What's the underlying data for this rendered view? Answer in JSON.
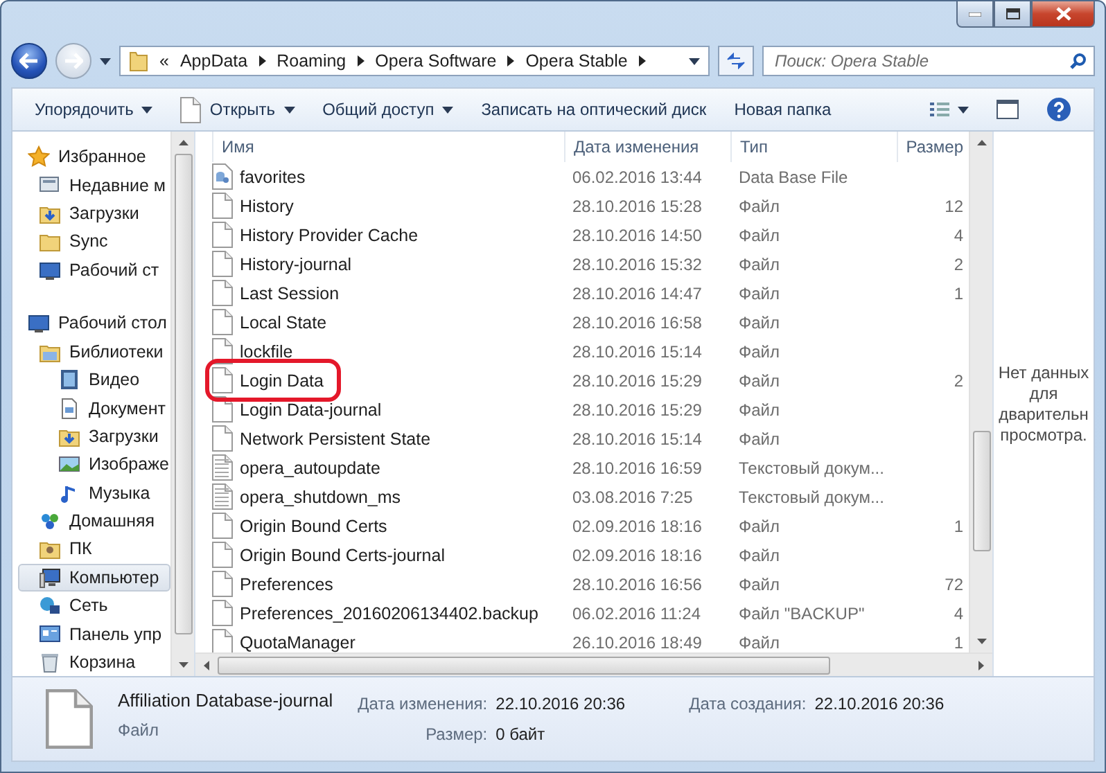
{
  "address_bar": {
    "overflow": "«",
    "segments": [
      "AppData",
      "Roaming",
      "Opera Software",
      "Opera Stable"
    ]
  },
  "search": {
    "placeholder": "Поиск: Opera Stable"
  },
  "toolbar": {
    "buttons": [
      {
        "label": "Упорядочить",
        "kind": "menu"
      },
      {
        "label": "Открыть",
        "kind": "open"
      },
      {
        "label": "Общий доступ",
        "kind": "menu"
      },
      {
        "label": "Записать на оптический диск",
        "kind": "plain"
      },
      {
        "label": "Новая папка",
        "kind": "plain"
      }
    ]
  },
  "navigation": [
    {
      "label": "Избранное",
      "kind": "star",
      "selected": false,
      "children": [
        {
          "label": "Недавние м",
          "kind": "recent",
          "selected": false
        },
        {
          "label": "Загрузки",
          "kind": "downloads",
          "selected": false
        },
        {
          "label": "Sync",
          "kind": "folder",
          "selected": false
        },
        {
          "label": "Рабочий ст",
          "kind": "desktop",
          "selected": false
        }
      ]
    },
    {
      "label": "Рабочий стол",
      "kind": "desktop",
      "selected": false,
      "children": [
        {
          "label": "Библиотеки",
          "kind": "library",
          "selected": false,
          "children": [
            {
              "label": "Видео",
              "kind": "video",
              "selected": false
            },
            {
              "label": "Документ",
              "kind": "document",
              "selected": false
            },
            {
              "label": "Загрузки",
              "kind": "downloads",
              "selected": false
            },
            {
              "label": "Изображе",
              "kind": "image",
              "selected": false
            },
            {
              "label": "Музыка",
              "kind": "music",
              "selected": false
            }
          ]
        },
        {
          "label": "Домашняя",
          "kind": "homegroup",
          "selected": false
        },
        {
          "label": "ПК",
          "kind": "user",
          "selected": false
        },
        {
          "label": "Компьютер",
          "kind": "computer",
          "selected": true
        },
        {
          "label": "Сеть",
          "kind": "network",
          "selected": false
        },
        {
          "label": "Панель упр",
          "kind": "control",
          "selected": false
        },
        {
          "label": "Корзина",
          "kind": "trash",
          "selected": false
        }
      ]
    }
  ],
  "table": {
    "columns": [
      "Имя",
      "Дата изменения",
      "Тип",
      "Размер"
    ],
    "rows": [
      {
        "name": "favorites",
        "kind": "database",
        "date": "06.02.2016 13:44",
        "type": "Data Base File",
        "size": ""
      },
      {
        "name": "History",
        "kind": "file",
        "date": "28.10.2016 15:28",
        "type": "Файл",
        "size": "12"
      },
      {
        "name": "History Provider Cache",
        "kind": "file",
        "date": "28.10.2016 14:50",
        "type": "Файл",
        "size": "4"
      },
      {
        "name": "History-journal",
        "kind": "file",
        "date": "28.10.2016 15:32",
        "type": "Файл",
        "size": "2"
      },
      {
        "name": "Last Session",
        "kind": "file",
        "date": "28.10.2016 14:47",
        "type": "Файл",
        "size": "1"
      },
      {
        "name": "Local State",
        "kind": "file",
        "date": "28.10.2016 16:58",
        "type": "Файл",
        "size": ""
      },
      {
        "name": "lockfile",
        "kind": "file",
        "date": "28.10.2016 15:14",
        "type": "Файл",
        "size": ""
      },
      {
        "name": "Login Data",
        "kind": "file",
        "date": "28.10.2016 15:29",
        "type": "Файл",
        "size": "2",
        "circled": true
      },
      {
        "name": "Login Data-journal",
        "kind": "file",
        "date": "28.10.2016 15:29",
        "type": "Файл",
        "size": ""
      },
      {
        "name": "Network Persistent State",
        "kind": "file",
        "date": "28.10.2016 15:14",
        "type": "Файл",
        "size": ""
      },
      {
        "name": "opera_autoupdate",
        "kind": "text",
        "date": "28.10.2016 16:59",
        "type": "Текстовый докум...",
        "size": ""
      },
      {
        "name": "opera_shutdown_ms",
        "kind": "text",
        "date": "03.08.2016 7:25",
        "type": "Текстовый докум...",
        "size": ""
      },
      {
        "name": "Origin Bound Certs",
        "kind": "file",
        "date": "02.09.2016 18:16",
        "type": "Файл",
        "size": "1"
      },
      {
        "name": "Origin Bound Certs-journal",
        "kind": "file",
        "date": "02.09.2016 18:16",
        "type": "Файл",
        "size": ""
      },
      {
        "name": "Preferences",
        "kind": "file",
        "date": "28.10.2016 16:56",
        "type": "Файл",
        "size": "72"
      },
      {
        "name": "Preferences_20160206134402.backup",
        "kind": "file",
        "date": "06.02.2016 11:24",
        "type": "Файл \"BACKUP\"",
        "size": "4"
      },
      {
        "name": "QuotaManager",
        "kind": "file",
        "date": "26.10.2016 18:49",
        "type": "Файл",
        "size": "1"
      }
    ]
  },
  "preview": {
    "lines": [
      "Нет данных",
      "для",
      "дварительн",
      "просмотра."
    ]
  },
  "details": {
    "name": "Affiliation Database-journal",
    "type": "Файл",
    "fields": [
      {
        "label": "Дата изменения:",
        "value": "22.10.2016 20:36"
      },
      {
        "label": "Размер:",
        "value": "0 байт"
      },
      {
        "label": "Дата создания:",
        "value": "22.10.2016 20:36"
      }
    ]
  }
}
